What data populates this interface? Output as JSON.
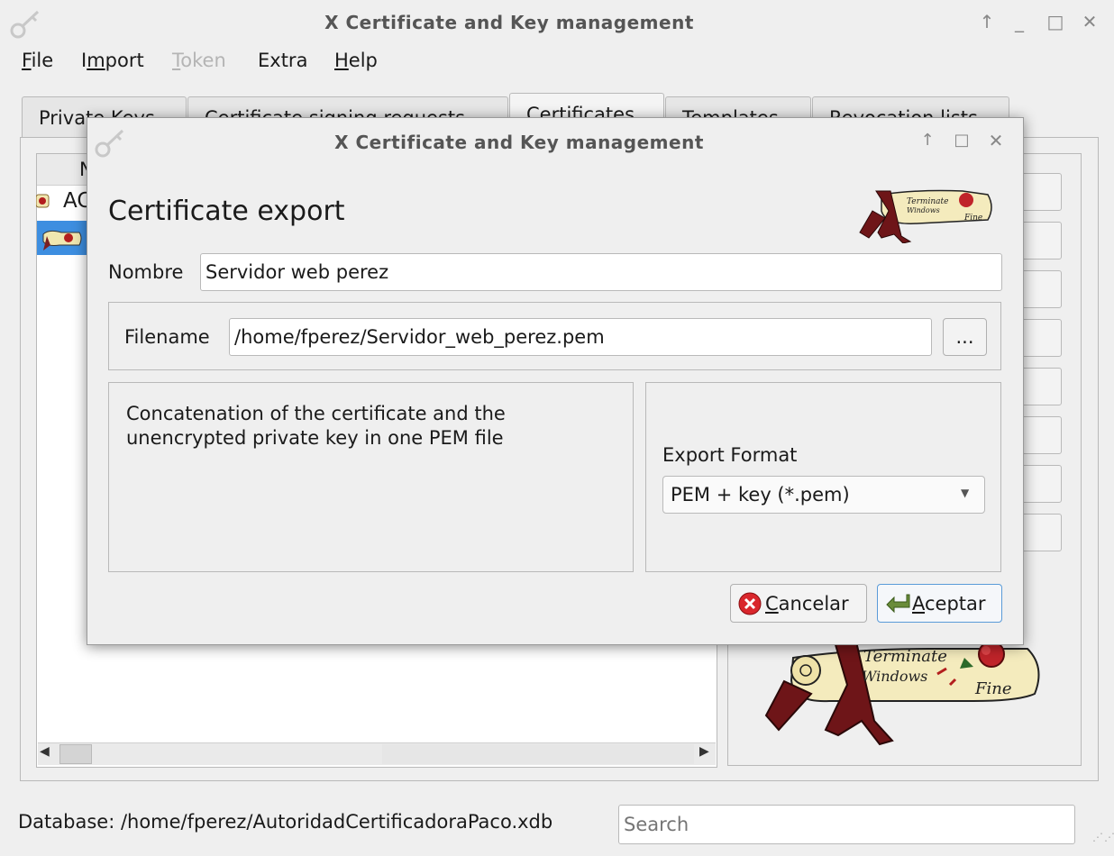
{
  "window": {
    "title": "X Certificate and Key management",
    "menu": [
      {
        "label": "File"
      },
      {
        "label": "Import"
      },
      {
        "label": "Token",
        "disabled": true
      },
      {
        "label": "Extra"
      },
      {
        "label": "Help"
      }
    ],
    "tabs": [
      "Private Keys",
      "Certificate signing requests",
      "Certificates",
      "Templates",
      "Revocation lists"
    ],
    "active_tab": "Certificates",
    "list": {
      "header_fragment": "N",
      "row1_fragment": "AC"
    },
    "status": "Database: /home/fperez/AutoridadCertificadoraPaco.xdb",
    "search_placeholder": "Search",
    "logo_text": "Terminate Windows Fine"
  },
  "dialog": {
    "title": "X Certificate and Key management",
    "heading": "Certificate export",
    "name_label": "Nombre",
    "name_value": "Servidor web perez",
    "filename_label": "Filename",
    "filename_value": "/home/fperez/Servidor_web_perez.pem",
    "browse_label": "...",
    "description_line1": "Concatenation of the certificate and the",
    "description_line2": "unencrypted private key in one PEM file",
    "format_label": "Export Format",
    "format_value": "PEM + key (*.pem)",
    "cancel_label": "Cancelar",
    "ok_label": "Aceptar"
  },
  "colors": {
    "selection": "#3d8ee0",
    "default_button_border": "#5a9bd8",
    "cancel_icon": "#d9262c",
    "ok_icon": "#6a8c3a"
  }
}
